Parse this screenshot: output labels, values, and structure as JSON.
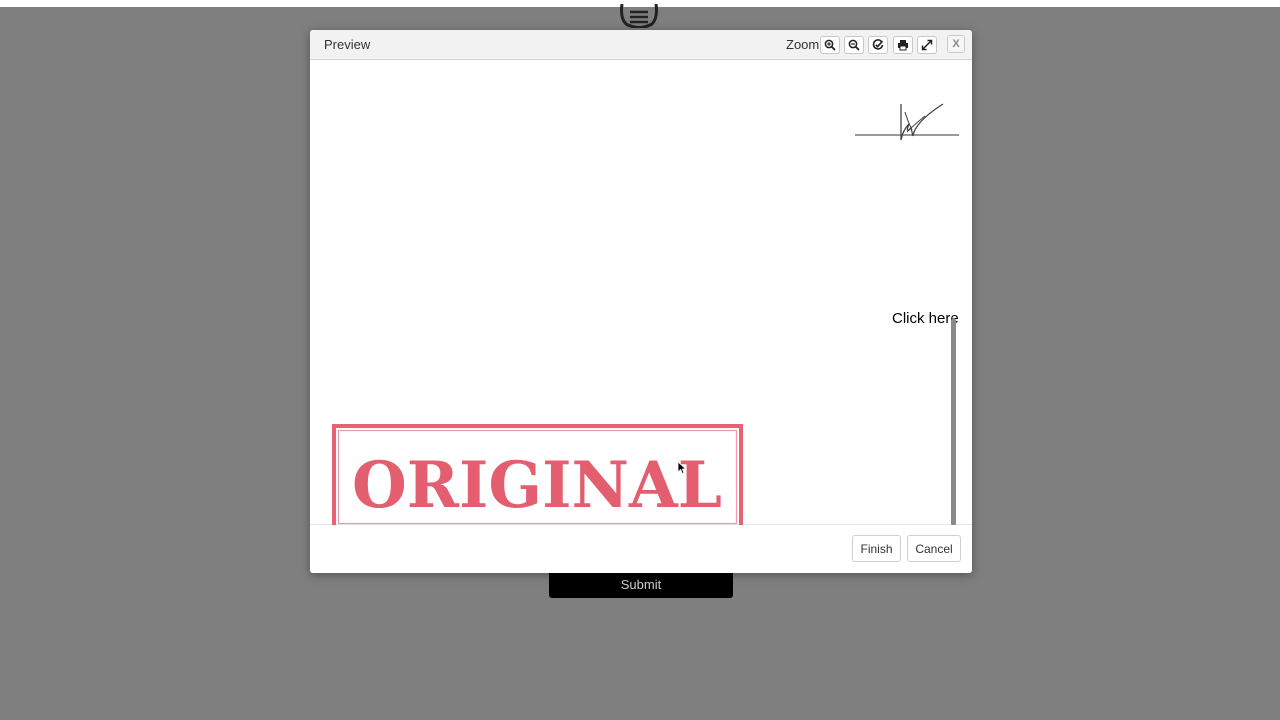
{
  "background_form": {
    "submit_label": "Submit"
  },
  "dialog": {
    "title": "Preview",
    "zoom_label": "Zoom:",
    "tools": [
      {
        "name": "zoom-in-icon"
      },
      {
        "name": "zoom-out-icon"
      },
      {
        "name": "fit-check-icon"
      },
      {
        "name": "print-icon"
      },
      {
        "name": "fullscreen-icon"
      }
    ],
    "close_label": "X",
    "document": {
      "click_here_text": "Click here",
      "stamp_text": "ORIGINAL",
      "stamp_color": "#e0485c"
    },
    "footer": {
      "finish_label": "Finish",
      "cancel_label": "Cancel"
    }
  },
  "colors": {
    "overlay": "#7f7f7f",
    "header_bg": "#f2f2f2",
    "submit_bg": "#000000"
  }
}
